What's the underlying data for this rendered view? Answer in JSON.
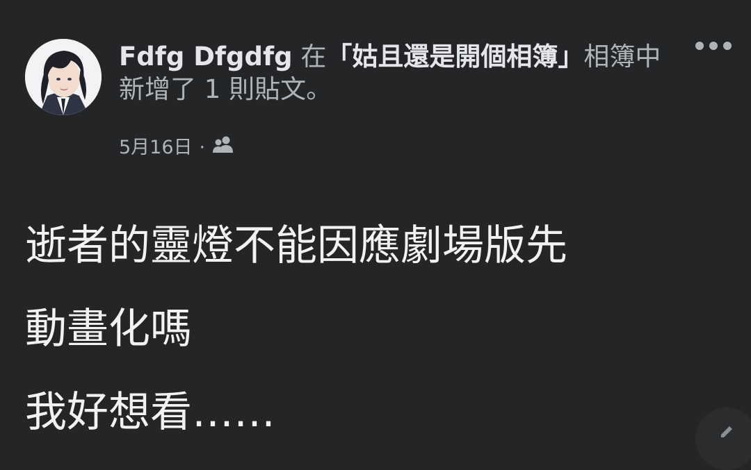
{
  "post": {
    "author_name": "Fdfg Dfgdfg",
    "action_prefix": "在",
    "album_name": "「姑且還是開個相簿」",
    "action_suffix": "相簿中新增了 1 則貼文。",
    "date": "5月16日",
    "separator": "·",
    "privacy_icon": "friends-icon",
    "more_icon": "more-options-icon",
    "lines": [
      "逝者的靈燈不能因應劇場版先",
      "動畫化嗎",
      "我好想看……"
    ]
  },
  "colors": {
    "background": "#242526",
    "primary_text": "#e4e6eb",
    "secondary_text": "#b0b3b8"
  }
}
